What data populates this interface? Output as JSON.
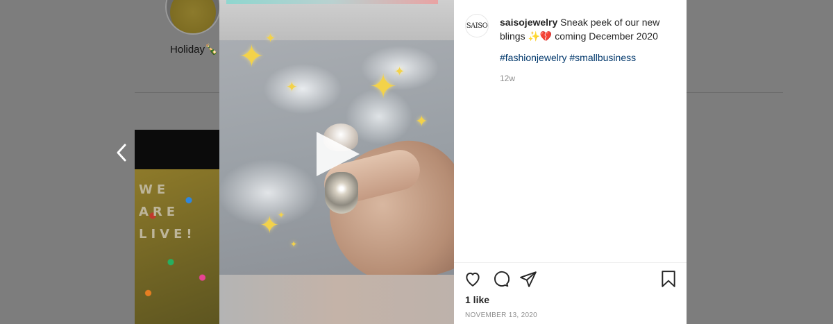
{
  "background": {
    "highlight_label": "Holiday🍾",
    "thumb_text": "WE ARE LIVE!"
  },
  "post": {
    "avatar_text": "SAISO",
    "username": "saisojewelry",
    "caption": "Sneak peek of our new blings ✨💔 coming December 2020",
    "hashtags": [
      "#fashionjewelry",
      "#smallbusiness"
    ],
    "age": "12w",
    "likes": "1 like",
    "date": "NOVEMBER 13, 2020"
  },
  "icons": {
    "prev": "chevron-left-icon",
    "play": "play-icon",
    "like": "heart-icon",
    "comment": "comment-icon",
    "share": "send-icon",
    "save": "bookmark-icon"
  },
  "colors": {
    "hashtag": "#00376b",
    "overlay": "#7d7d7d",
    "sparkle": "#f3d24a"
  }
}
